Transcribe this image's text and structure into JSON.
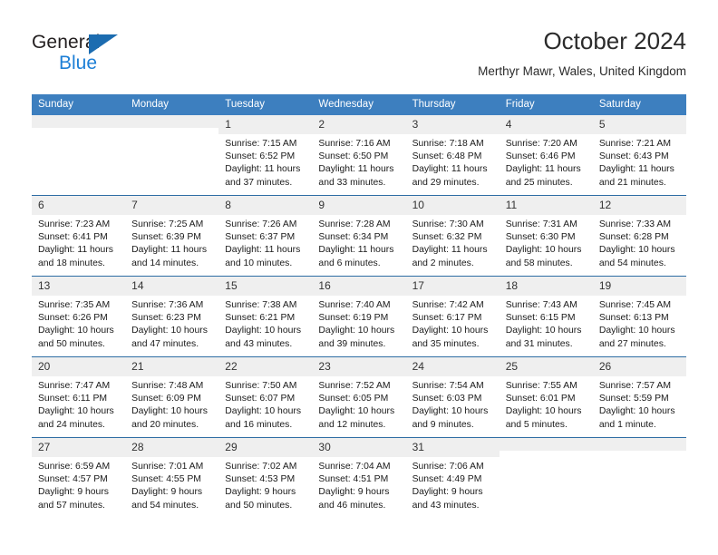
{
  "brand": {
    "name_part1": "General",
    "name_part2": "Blue",
    "triangle_color": "#1c6cb0",
    "blue_text_color": "#1d7fd6"
  },
  "header": {
    "title": "October 2024",
    "subtitle": "Merthyr Mawr, Wales, United Kingdom"
  },
  "theme": {
    "header_row_bg": "#3d7fbf",
    "daynum_bg": "#efefef",
    "row_separator": "#2e6da4"
  },
  "weekdays": [
    "Sunday",
    "Monday",
    "Tuesday",
    "Wednesday",
    "Thursday",
    "Friday",
    "Saturday"
  ],
  "weeks": [
    [
      {
        "day": "",
        "lines": []
      },
      {
        "day": "",
        "lines": []
      },
      {
        "day": "1",
        "lines": [
          "Sunrise: 7:15 AM",
          "Sunset: 6:52 PM",
          "Daylight: 11 hours",
          "and 37 minutes."
        ]
      },
      {
        "day": "2",
        "lines": [
          "Sunrise: 7:16 AM",
          "Sunset: 6:50 PM",
          "Daylight: 11 hours",
          "and 33 minutes."
        ]
      },
      {
        "day": "3",
        "lines": [
          "Sunrise: 7:18 AM",
          "Sunset: 6:48 PM",
          "Daylight: 11 hours",
          "and 29 minutes."
        ]
      },
      {
        "day": "4",
        "lines": [
          "Sunrise: 7:20 AM",
          "Sunset: 6:46 PM",
          "Daylight: 11 hours",
          "and 25 minutes."
        ]
      },
      {
        "day": "5",
        "lines": [
          "Sunrise: 7:21 AM",
          "Sunset: 6:43 PM",
          "Daylight: 11 hours",
          "and 21 minutes."
        ]
      }
    ],
    [
      {
        "day": "6",
        "lines": [
          "Sunrise: 7:23 AM",
          "Sunset: 6:41 PM",
          "Daylight: 11 hours",
          "and 18 minutes."
        ]
      },
      {
        "day": "7",
        "lines": [
          "Sunrise: 7:25 AM",
          "Sunset: 6:39 PM",
          "Daylight: 11 hours",
          "and 14 minutes."
        ]
      },
      {
        "day": "8",
        "lines": [
          "Sunrise: 7:26 AM",
          "Sunset: 6:37 PM",
          "Daylight: 11 hours",
          "and 10 minutes."
        ]
      },
      {
        "day": "9",
        "lines": [
          "Sunrise: 7:28 AM",
          "Sunset: 6:34 PM",
          "Daylight: 11 hours",
          "and 6 minutes."
        ]
      },
      {
        "day": "10",
        "lines": [
          "Sunrise: 7:30 AM",
          "Sunset: 6:32 PM",
          "Daylight: 11 hours",
          "and 2 minutes."
        ]
      },
      {
        "day": "11",
        "lines": [
          "Sunrise: 7:31 AM",
          "Sunset: 6:30 PM",
          "Daylight: 10 hours",
          "and 58 minutes."
        ]
      },
      {
        "day": "12",
        "lines": [
          "Sunrise: 7:33 AM",
          "Sunset: 6:28 PM",
          "Daylight: 10 hours",
          "and 54 minutes."
        ]
      }
    ],
    [
      {
        "day": "13",
        "lines": [
          "Sunrise: 7:35 AM",
          "Sunset: 6:26 PM",
          "Daylight: 10 hours",
          "and 50 minutes."
        ]
      },
      {
        "day": "14",
        "lines": [
          "Sunrise: 7:36 AM",
          "Sunset: 6:23 PM",
          "Daylight: 10 hours",
          "and 47 minutes."
        ]
      },
      {
        "day": "15",
        "lines": [
          "Sunrise: 7:38 AM",
          "Sunset: 6:21 PM",
          "Daylight: 10 hours",
          "and 43 minutes."
        ]
      },
      {
        "day": "16",
        "lines": [
          "Sunrise: 7:40 AM",
          "Sunset: 6:19 PM",
          "Daylight: 10 hours",
          "and 39 minutes."
        ]
      },
      {
        "day": "17",
        "lines": [
          "Sunrise: 7:42 AM",
          "Sunset: 6:17 PM",
          "Daylight: 10 hours",
          "and 35 minutes."
        ]
      },
      {
        "day": "18",
        "lines": [
          "Sunrise: 7:43 AM",
          "Sunset: 6:15 PM",
          "Daylight: 10 hours",
          "and 31 minutes."
        ]
      },
      {
        "day": "19",
        "lines": [
          "Sunrise: 7:45 AM",
          "Sunset: 6:13 PM",
          "Daylight: 10 hours",
          "and 27 minutes."
        ]
      }
    ],
    [
      {
        "day": "20",
        "lines": [
          "Sunrise: 7:47 AM",
          "Sunset: 6:11 PM",
          "Daylight: 10 hours",
          "and 24 minutes."
        ]
      },
      {
        "day": "21",
        "lines": [
          "Sunrise: 7:48 AM",
          "Sunset: 6:09 PM",
          "Daylight: 10 hours",
          "and 20 minutes."
        ]
      },
      {
        "day": "22",
        "lines": [
          "Sunrise: 7:50 AM",
          "Sunset: 6:07 PM",
          "Daylight: 10 hours",
          "and 16 minutes."
        ]
      },
      {
        "day": "23",
        "lines": [
          "Sunrise: 7:52 AM",
          "Sunset: 6:05 PM",
          "Daylight: 10 hours",
          "and 12 minutes."
        ]
      },
      {
        "day": "24",
        "lines": [
          "Sunrise: 7:54 AM",
          "Sunset: 6:03 PM",
          "Daylight: 10 hours",
          "and 9 minutes."
        ]
      },
      {
        "day": "25",
        "lines": [
          "Sunrise: 7:55 AM",
          "Sunset: 6:01 PM",
          "Daylight: 10 hours",
          "and 5 minutes."
        ]
      },
      {
        "day": "26",
        "lines": [
          "Sunrise: 7:57 AM",
          "Sunset: 5:59 PM",
          "Daylight: 10 hours",
          "and 1 minute."
        ]
      }
    ],
    [
      {
        "day": "27",
        "lines": [
          "Sunrise: 6:59 AM",
          "Sunset: 4:57 PM",
          "Daylight: 9 hours",
          "and 57 minutes."
        ]
      },
      {
        "day": "28",
        "lines": [
          "Sunrise: 7:01 AM",
          "Sunset: 4:55 PM",
          "Daylight: 9 hours",
          "and 54 minutes."
        ]
      },
      {
        "day": "29",
        "lines": [
          "Sunrise: 7:02 AM",
          "Sunset: 4:53 PM",
          "Daylight: 9 hours",
          "and 50 minutes."
        ]
      },
      {
        "day": "30",
        "lines": [
          "Sunrise: 7:04 AM",
          "Sunset: 4:51 PM",
          "Daylight: 9 hours",
          "and 46 minutes."
        ]
      },
      {
        "day": "31",
        "lines": [
          "Sunrise: 7:06 AM",
          "Sunset: 4:49 PM",
          "Daylight: 9 hours",
          "and 43 minutes."
        ]
      },
      {
        "day": "",
        "lines": []
      },
      {
        "day": "",
        "lines": []
      }
    ]
  ]
}
